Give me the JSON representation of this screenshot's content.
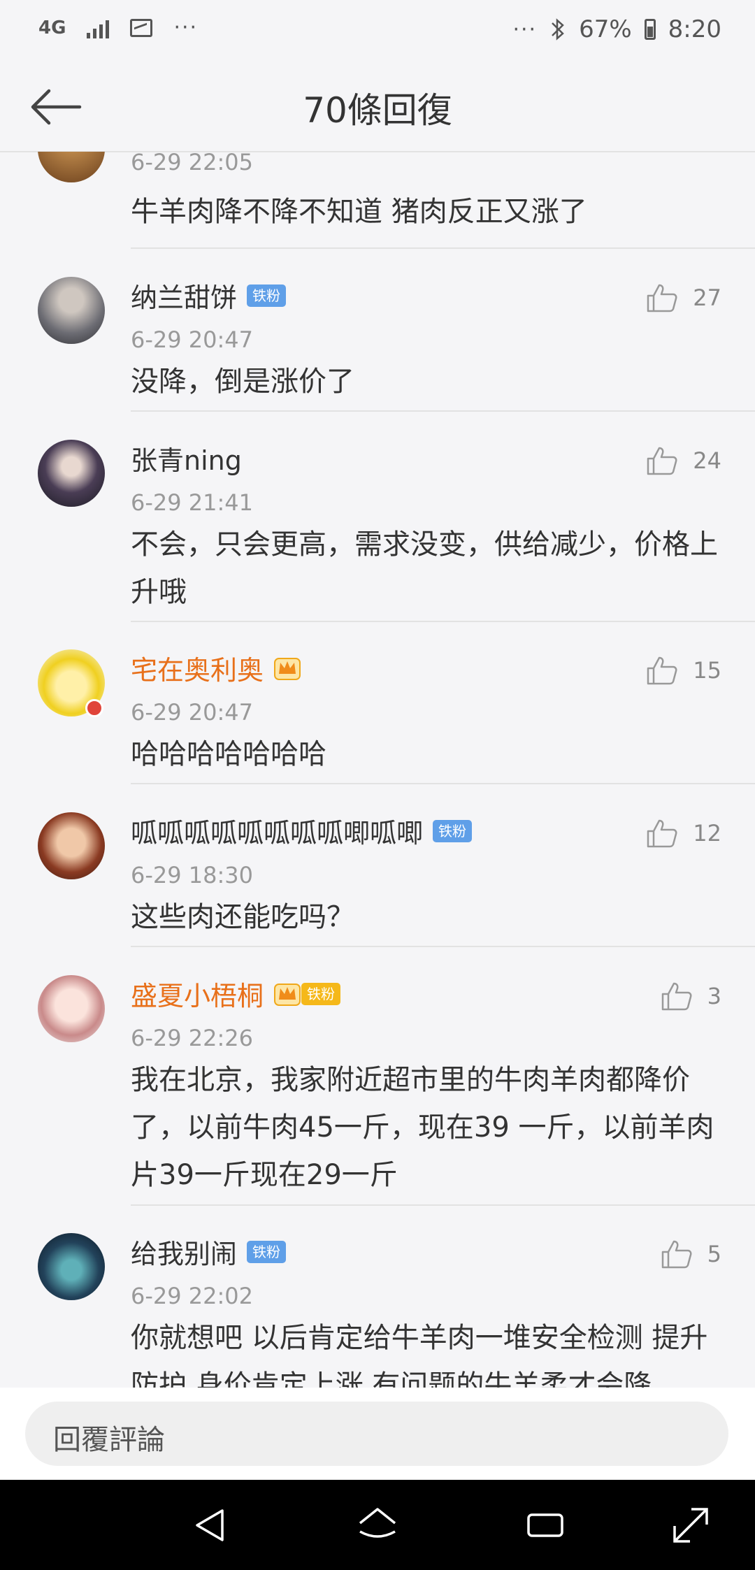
{
  "status_bar": {
    "network": "4G",
    "more": "···",
    "bluetooth": "∗",
    "battery": "67%",
    "time": "8:20"
  },
  "header": {
    "title": "70條回復"
  },
  "comments": [
    {
      "name": "",
      "time": "6-29 22:05",
      "text": "牛羊肉降不降不知道 猪肉反正又涨了",
      "likes": ""
    },
    {
      "name": "纳兰甜饼",
      "badge": "铁粉",
      "time": "6-29 20:47",
      "text": "没降，倒是涨价了",
      "likes": "27"
    },
    {
      "name": "张青ning",
      "time": "6-29 21:41",
      "text": "不会，只会更高，需求没变，供给减少，价格上升哦",
      "likes": "24"
    },
    {
      "name": "宅在奥利奥",
      "time": "6-29 20:47",
      "text": "哈哈哈哈哈哈哈",
      "likes": "15"
    },
    {
      "name": "呱呱呱呱呱呱呱呱唧呱唧",
      "badge": "铁粉",
      "time": "6-29 18:30",
      "text": "这些肉还能吃吗？",
      "likes": "12"
    },
    {
      "name": "盛夏小梧桐",
      "badge": "铁粉",
      "time": "6-29 22:26",
      "text": "我在北京，我家附近超市里的牛肉羊肉都降价了，以前牛肉45一斤，现在39 一斤，以前羊肉片39一斤现在29一斤",
      "likes": "3"
    },
    {
      "name": "给我别闹",
      "badge": "铁粉",
      "time": "6-29 22:02",
      "text": "你就想吧 以后肯定给牛羊肉一堆安全检测 提升防护 身价肯定上涨 有问题的牛羊柔才会降",
      "likes": "5"
    }
  ],
  "reply": {
    "placeholder": "回覆評論"
  },
  "colors": {
    "vip_name": "#e8701a",
    "badge": "#5f9fe8",
    "background": "#f5f5f7"
  }
}
